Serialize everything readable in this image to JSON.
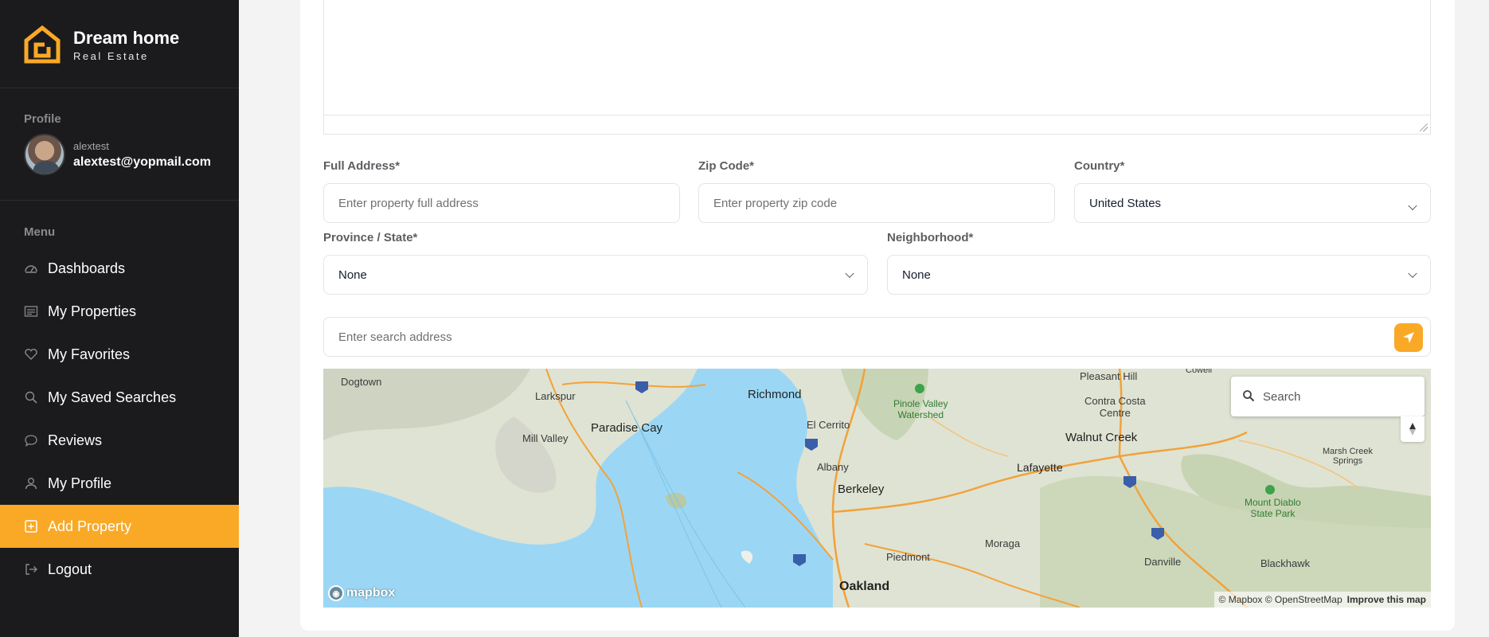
{
  "brand": {
    "name": "Dream home",
    "subtitle": "Real Estate",
    "accent": "#f9a926"
  },
  "profile": {
    "section_label": "Profile",
    "username": "alextest",
    "email": "alextest@yopmail.com"
  },
  "menu": {
    "section_label": "Menu",
    "items": [
      {
        "label": "Dashboards",
        "icon": "dashboard-icon"
      },
      {
        "label": "My Properties",
        "icon": "list-icon"
      },
      {
        "label": "My Favorites",
        "icon": "heart-icon"
      },
      {
        "label": "My Saved Searches",
        "icon": "search-icon"
      },
      {
        "label": "Reviews",
        "icon": "chat-icon"
      },
      {
        "label": "My Profile",
        "icon": "user-icon"
      },
      {
        "label": "Add Property",
        "icon": "plus-square-icon",
        "active": true
      },
      {
        "label": "Logout",
        "icon": "logout-icon"
      }
    ]
  },
  "form": {
    "full_address": {
      "label": "Full Address*",
      "placeholder": "Enter property full address"
    },
    "zip_code": {
      "label": "Zip Code*",
      "placeholder": "Enter property zip code"
    },
    "country": {
      "label": "Country*",
      "value": "United States"
    },
    "province": {
      "label": "Province / State*",
      "value": "None"
    },
    "neighborhood": {
      "label": "Neighborhood*",
      "value": "None"
    },
    "search_address": {
      "placeholder": "Enter search address"
    }
  },
  "map": {
    "search_placeholder": "Search",
    "logo_text": "mapbox",
    "attribution": "© Mapbox © OpenStreetMap",
    "improve_link": "Improve this map",
    "labels": {
      "dogtown": "Dogtown",
      "larkspur": "Larkspur",
      "mill_valley": "Mill Valley",
      "paradise_cay": "Paradise Cay",
      "richmond": "Richmond",
      "el_cerrito": "El Cerrito",
      "albany": "Albany",
      "berkeley": "Berkeley",
      "piedmont": "Piedmont",
      "oakland": "Oakland",
      "pinole": "Pinole Valley\nWatershed",
      "pleasant_hill": "Pleasant Hill",
      "contra_costa": "Contra Costa\nCentre",
      "walnut_creek": "Walnut Creek",
      "lafayette": "Lafayette",
      "moraga": "Moraga",
      "danville": "Danville",
      "blackhawk": "Blackhawk",
      "mount_diablo": "Mount Diablo\nState Park",
      "marsh_creek": "Marsh Creek\nSprings",
      "cowell": "Cowell"
    }
  }
}
